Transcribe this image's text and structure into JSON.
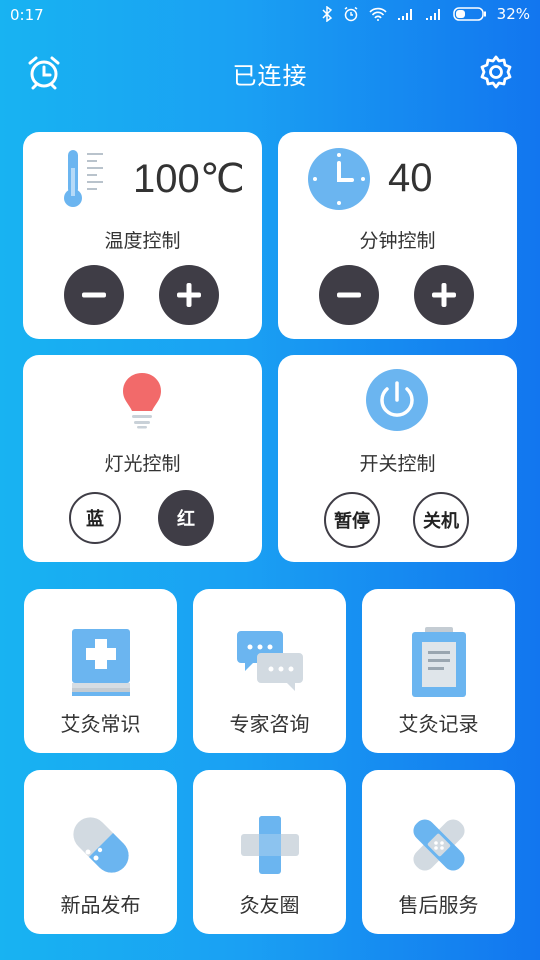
{
  "status": {
    "time": "0:17",
    "battery": "32%"
  },
  "header": {
    "title": "已连接",
    "alarm_icon": "alarm-clock-icon",
    "settings_icon": "gear-icon"
  },
  "controls": {
    "temperature": {
      "value": "100℃",
      "label": "温度控制"
    },
    "minutes": {
      "value": "40",
      "label": "分钟控制"
    },
    "light": {
      "label": "灯光控制",
      "option_blue": "蓝",
      "option_red": "红"
    },
    "power": {
      "label": "开关控制",
      "pause": "暂停",
      "off": "关机"
    }
  },
  "tiles": [
    {
      "label": "艾灸常识",
      "icon": "medical-book-icon"
    },
    {
      "label": "专家咨询",
      "icon": "chat-bubbles-icon"
    },
    {
      "label": "艾灸记录",
      "icon": "clipboard-icon"
    },
    {
      "label": "新品发布",
      "icon": "capsule-icon"
    },
    {
      "label": "灸友圈",
      "icon": "medical-cross-icon"
    },
    {
      "label": "售后服务",
      "icon": "bandage-icon"
    }
  ],
  "colors": {
    "bg_left": "#18b3f2",
    "bg_right": "#1276ef",
    "dark_button": "#3f3d46",
    "icon_blue": "#6bb5f0",
    "bulb_red": "#f26a6a"
  }
}
